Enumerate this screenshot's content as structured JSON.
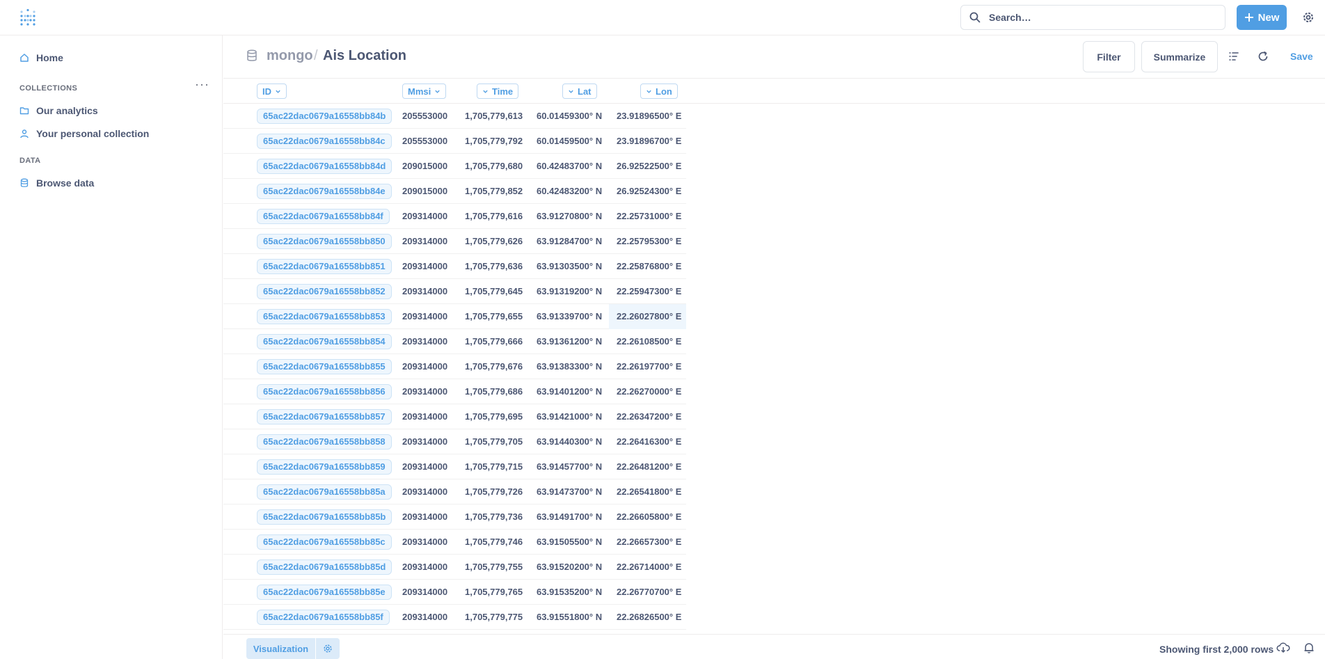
{
  "app": {
    "search_placeholder": "Search…",
    "new_label": "New",
    "brand_color": "#509ee3"
  },
  "sidebar": {
    "home": "Home",
    "collections_label": "COLLECTIONS",
    "collections": [
      "Our analytics",
      "Your personal collection"
    ],
    "data_label": "DATA",
    "browse": "Browse data"
  },
  "header": {
    "database": "mongo",
    "separator": "/",
    "table": "Ais Location",
    "filter": "Filter",
    "summarize": "Summarize",
    "save": "Save"
  },
  "table": {
    "columns": [
      "ID",
      "Mmsi",
      "Time",
      "Lat",
      "Lon"
    ],
    "rows": [
      [
        "65ac22dac0679a16558bb84b",
        "205553000",
        "1,705,779,613",
        "60.01459300° N",
        "23.91896500° E"
      ],
      [
        "65ac22dac0679a16558bb84c",
        "205553000",
        "1,705,779,792",
        "60.01459500° N",
        "23.91896700° E"
      ],
      [
        "65ac22dac0679a16558bb84d",
        "209015000",
        "1,705,779,680",
        "60.42483700° N",
        "26.92522500° E"
      ],
      [
        "65ac22dac0679a16558bb84e",
        "209015000",
        "1,705,779,852",
        "60.42483200° N",
        "26.92524300° E"
      ],
      [
        "65ac22dac0679a16558bb84f",
        "209314000",
        "1,705,779,616",
        "63.91270800° N",
        "22.25731000° E"
      ],
      [
        "65ac22dac0679a16558bb850",
        "209314000",
        "1,705,779,626",
        "63.91284700° N",
        "22.25795300° E"
      ],
      [
        "65ac22dac0679a16558bb851",
        "209314000",
        "1,705,779,636",
        "63.91303500° N",
        "22.25876800° E"
      ],
      [
        "65ac22dac0679a16558bb852",
        "209314000",
        "1,705,779,645",
        "63.91319200° N",
        "22.25947300° E"
      ],
      [
        "65ac22dac0679a16558bb853",
        "209314000",
        "1,705,779,655",
        "63.91339700° N",
        "22.26027800° E"
      ],
      [
        "65ac22dac0679a16558bb854",
        "209314000",
        "1,705,779,666",
        "63.91361200° N",
        "22.26108500° E"
      ],
      [
        "65ac22dac0679a16558bb855",
        "209314000",
        "1,705,779,676",
        "63.91383300° N",
        "22.26197700° E"
      ],
      [
        "65ac22dac0679a16558bb856",
        "209314000",
        "1,705,779,686",
        "63.91401200° N",
        "22.26270000° E"
      ],
      [
        "65ac22dac0679a16558bb857",
        "209314000",
        "1,705,779,695",
        "63.91421000° N",
        "22.26347200° E"
      ],
      [
        "65ac22dac0679a16558bb858",
        "209314000",
        "1,705,779,705",
        "63.91440300° N",
        "22.26416300° E"
      ],
      [
        "65ac22dac0679a16558bb859",
        "209314000",
        "1,705,779,715",
        "63.91457700° N",
        "22.26481200° E"
      ],
      [
        "65ac22dac0679a16558bb85a",
        "209314000",
        "1,705,779,726",
        "63.91473700° N",
        "22.26541800° E"
      ],
      [
        "65ac22dac0679a16558bb85b",
        "209314000",
        "1,705,779,736",
        "63.91491700° N",
        "22.26605800° E"
      ],
      [
        "65ac22dac0679a16558bb85c",
        "209314000",
        "1,705,779,746",
        "63.91505500° N",
        "22.26657300° E"
      ],
      [
        "65ac22dac0679a16558bb85d",
        "209314000",
        "1,705,779,755",
        "63.91520200° N",
        "22.26714000° E"
      ],
      [
        "65ac22dac0679a16558bb85e",
        "209314000",
        "1,705,779,765",
        "63.91535200° N",
        "22.26770700° E"
      ],
      [
        "65ac22dac0679a16558bb85f",
        "209314000",
        "1,705,779,775",
        "63.91551800° N",
        "22.26826500° E"
      ]
    ],
    "highlighted_row": 8
  },
  "footer": {
    "visualization": "Visualization",
    "row_count": "Showing first 2,000 rows"
  }
}
